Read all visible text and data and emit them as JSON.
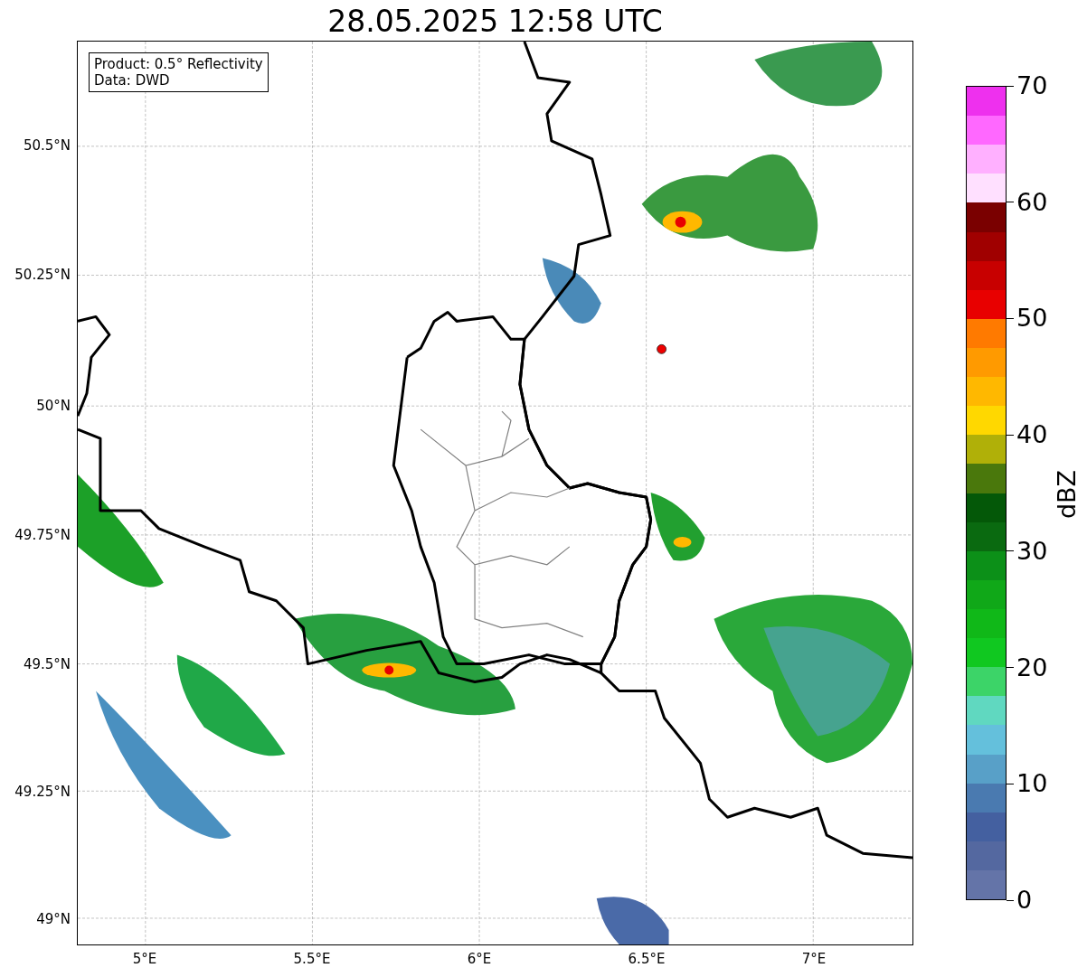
{
  "title": "28.05.2025 12:58 UTC",
  "map": {
    "info_box": [
      "Product: 0.5° Reflectivity",
      "Data: DWD"
    ],
    "y_ticks": [
      "50.5°N",
      "50.25°N",
      "50°N",
      "49.75°N",
      "49.5°N",
      "49.25°N",
      "49°N"
    ],
    "x_ticks": [
      "5°E",
      "5.5°E",
      "6°E",
      "6.5°E",
      "7°E"
    ]
  },
  "colorbar": {
    "label": "dBZ",
    "ticks": [
      "70",
      "60",
      "50",
      "40",
      "30",
      "20",
      "10",
      "0"
    ],
    "bins": [
      {
        "color": "#ee30ee"
      },
      {
        "color": "#ff68ff"
      },
      {
        "color": "#ffb0ff"
      },
      {
        "color": "#ffe0ff"
      },
      {
        "color": "#7a0000"
      },
      {
        "color": "#a00000"
      },
      {
        "color": "#c80000"
      },
      {
        "color": "#e80000"
      },
      {
        "color": "#ff7a00"
      },
      {
        "color": "#ff9a00"
      },
      {
        "color": "#ffb800"
      },
      {
        "color": "#ffd800"
      },
      {
        "color": "#b0b008"
      },
      {
        "color": "#4a780c"
      },
      {
        "color": "#045808"
      },
      {
        "color": "#0a6a10"
      },
      {
        "color": "#0c9018"
      },
      {
        "color": "#10a818"
      },
      {
        "color": "#10b818"
      },
      {
        "color": "#10c820"
      },
      {
        "color": "#3cd468"
      },
      {
        "color": "#60d8c0"
      },
      {
        "color": "#64c0dc"
      },
      {
        "color": "#58a0c8"
      },
      {
        "color": "#4a7ab0"
      },
      {
        "color": "#4460a0"
      },
      {
        "color": "#5468a0"
      },
      {
        "color": "#6474a8"
      }
    ]
  }
}
